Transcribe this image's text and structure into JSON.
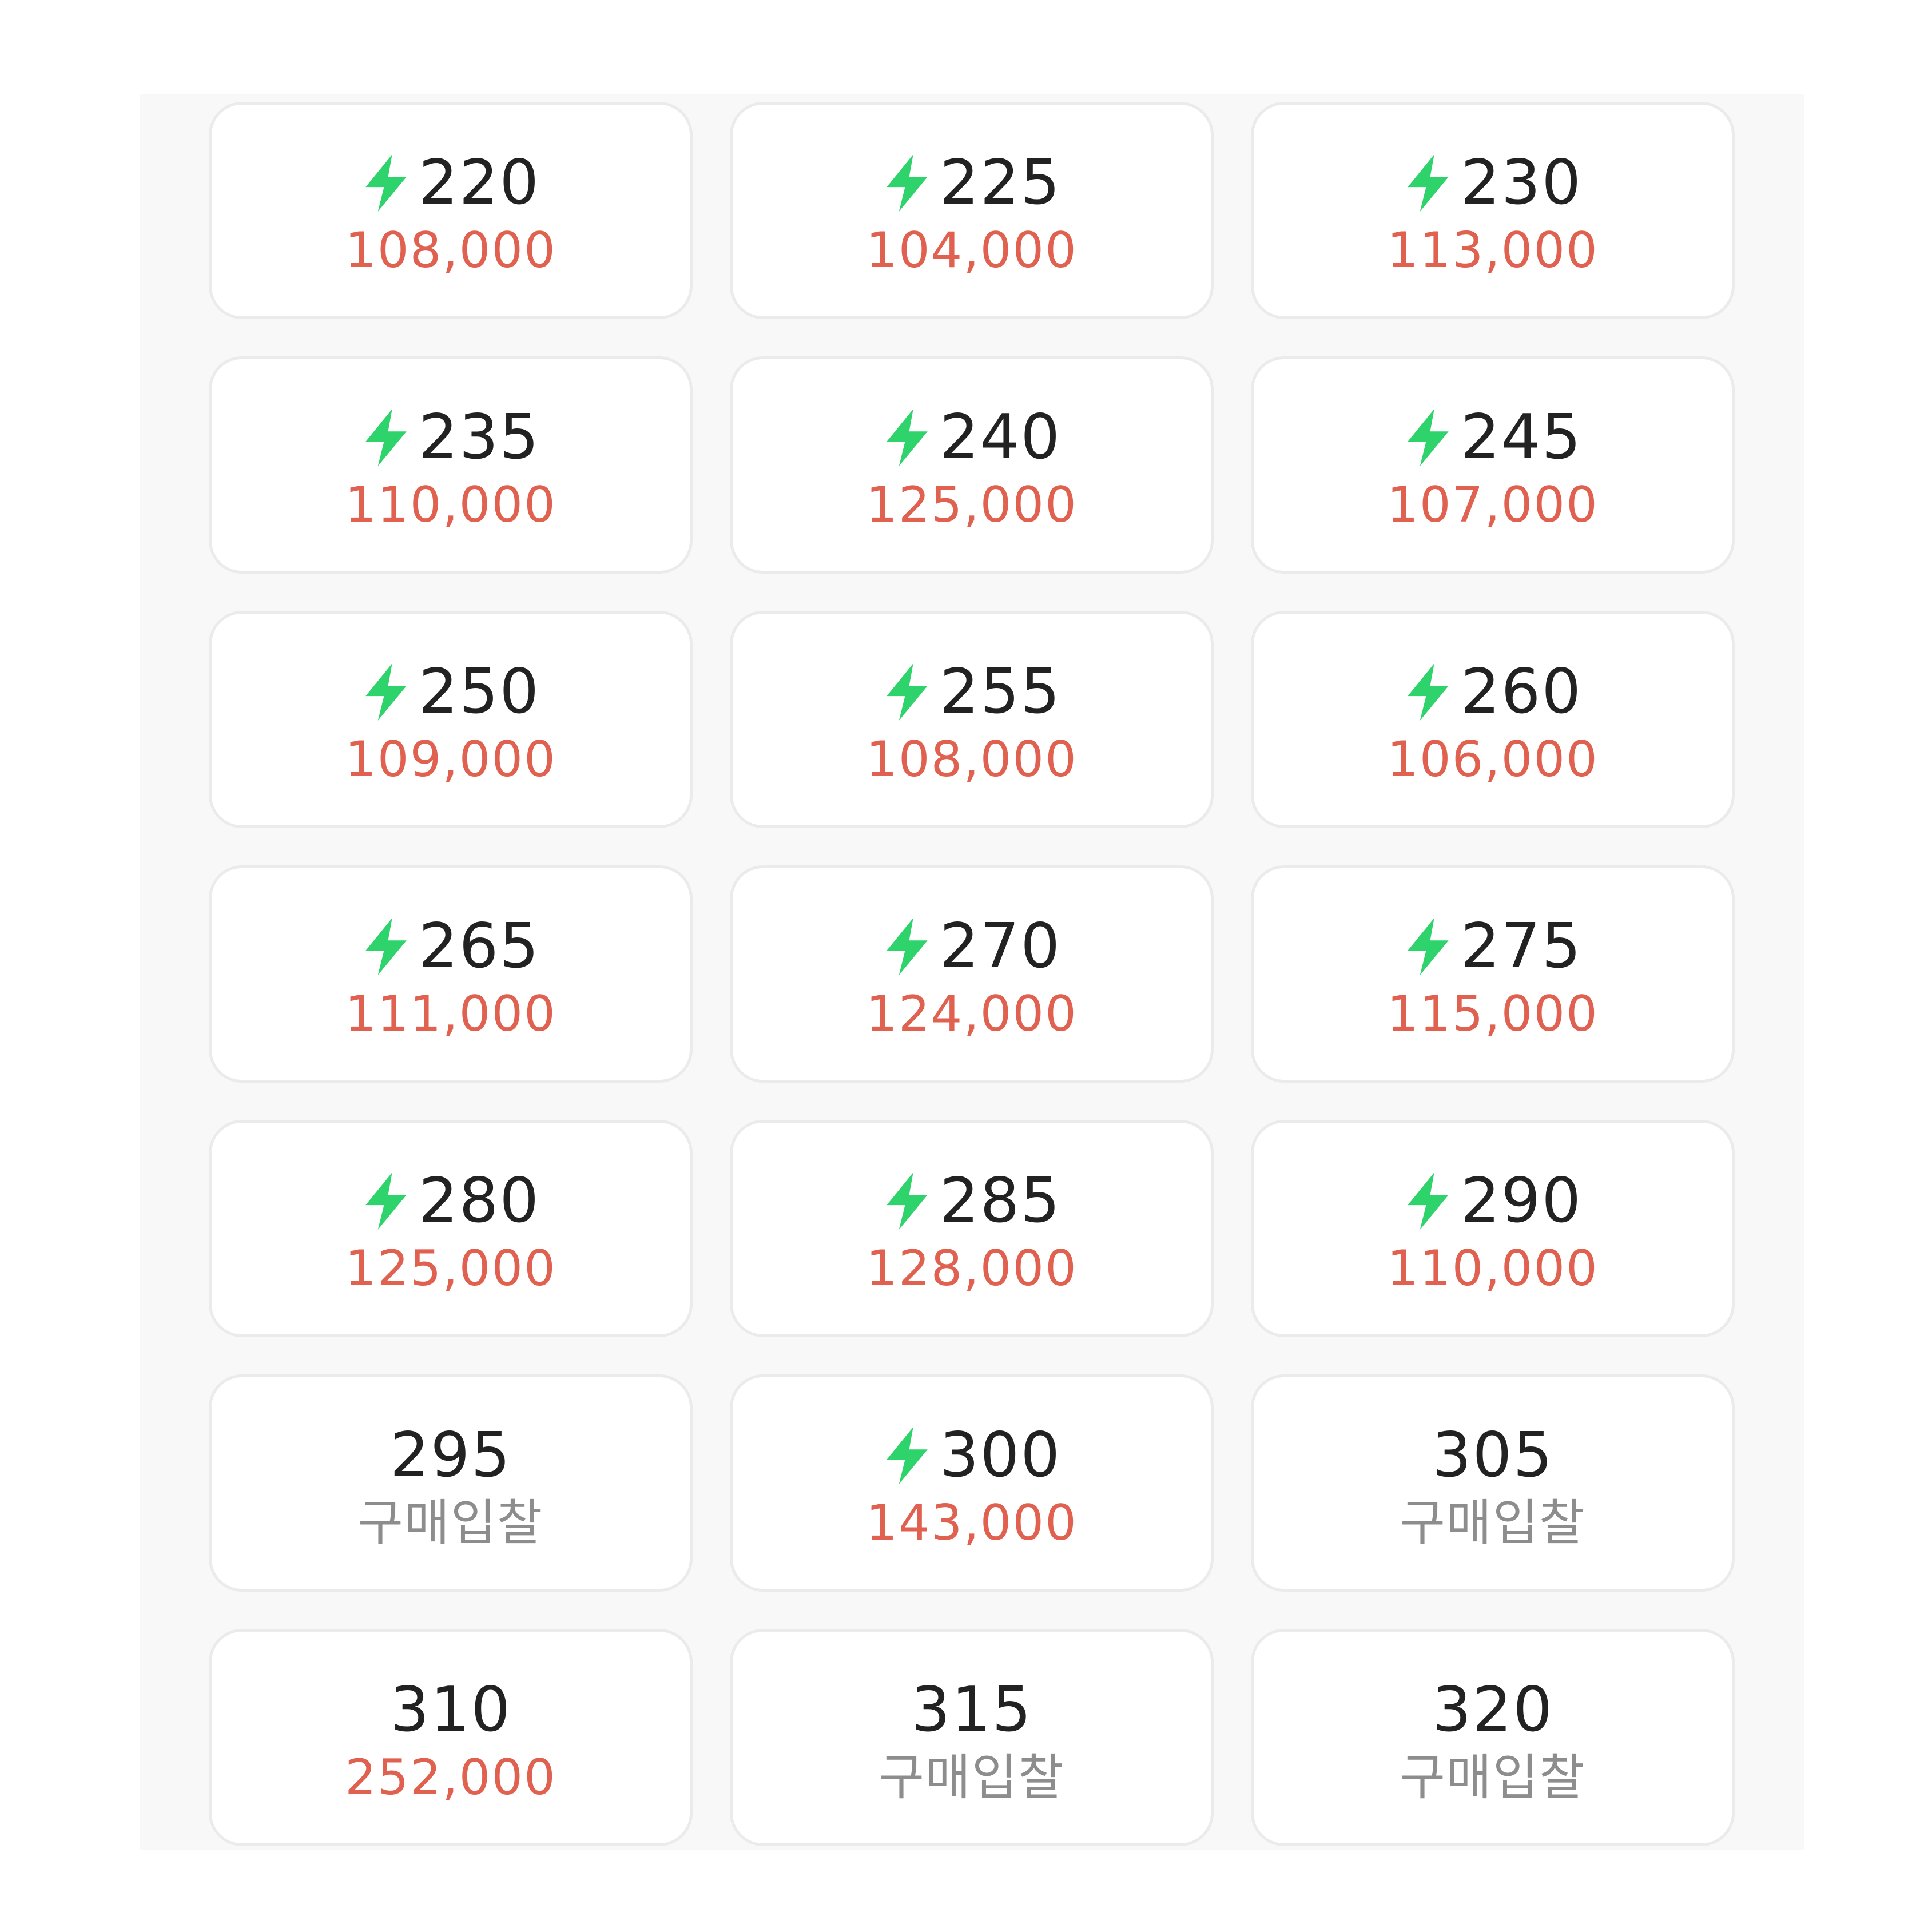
{
  "colors": {
    "bolt": "#2fd36b",
    "price": "#e0614f",
    "bid": "#8d8d8d",
    "size": "#222222",
    "card_border": "#ebebeb",
    "panel_bg": "#f8f8f8"
  },
  "options": [
    {
      "size": "220",
      "price": "108,000",
      "express": true
    },
    {
      "size": "225",
      "price": "104,000",
      "express": true
    },
    {
      "size": "230",
      "price": "113,000",
      "express": true
    },
    {
      "size": "235",
      "price": "110,000",
      "express": true
    },
    {
      "size": "240",
      "price": "125,000",
      "express": true
    },
    {
      "size": "245",
      "price": "107,000",
      "express": true
    },
    {
      "size": "250",
      "price": "109,000",
      "express": true
    },
    {
      "size": "255",
      "price": "108,000",
      "express": true
    },
    {
      "size": "260",
      "price": "106,000",
      "express": true
    },
    {
      "size": "265",
      "price": "111,000",
      "express": true
    },
    {
      "size": "270",
      "price": "124,000",
      "express": true
    },
    {
      "size": "275",
      "price": "115,000",
      "express": true
    },
    {
      "size": "280",
      "price": "125,000",
      "express": true
    },
    {
      "size": "285",
      "price": "128,000",
      "express": true
    },
    {
      "size": "290",
      "price": "110,000",
      "express": true
    },
    {
      "size": "295",
      "price": "구매입찰",
      "express": false
    },
    {
      "size": "300",
      "price": "143,000",
      "express": true
    },
    {
      "size": "305",
      "price": "구매입찰",
      "express": false
    },
    {
      "size": "310",
      "price": "252,000",
      "express": false
    },
    {
      "size": "315",
      "price": "구매입찰",
      "express": false
    },
    {
      "size": "320",
      "price": "구매입찰",
      "express": false
    }
  ]
}
